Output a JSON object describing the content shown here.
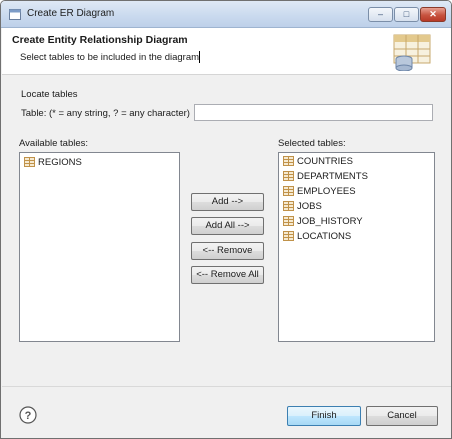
{
  "window": {
    "title": "Create ER Diagram",
    "controls": {
      "minimize": "–",
      "maximize": "□",
      "close": "✕"
    }
  },
  "header": {
    "title": "Create Entity Relationship Diagram",
    "description": "Select tables to be included in the diagram",
    "art_icon": "database-table-icon"
  },
  "locate": {
    "section_label": "Locate tables",
    "table_label": "Table: (* = any string, ? = any character)",
    "table_value": ""
  },
  "available": {
    "label": "Available tables:",
    "items": [
      "REGIONS"
    ]
  },
  "selected": {
    "label": "Selected tables:",
    "items": [
      "COUNTRIES",
      "DEPARTMENTS",
      "EMPLOYEES",
      "JOBS",
      "JOB_HISTORY",
      "LOCATIONS"
    ]
  },
  "actions": {
    "add": "Add -->",
    "add_all": "Add All -->",
    "remove": "<-- Remove",
    "remove_all": "<-- Remove All"
  },
  "footer": {
    "help_icon": "help-icon",
    "finish": "Finish",
    "cancel": "Cancel"
  },
  "colors": {
    "table_icon": "#d4a35a",
    "title_bar": "#c9d9ee",
    "close_button": "#c75340",
    "default_button": "#bee6fd"
  }
}
